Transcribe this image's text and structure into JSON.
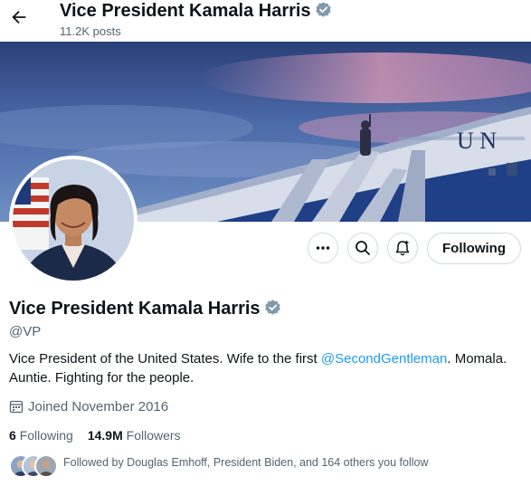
{
  "header": {
    "back_icon": "arrow-left-icon",
    "title": "Vice President Kamala Harris",
    "posts_count": "11.2K posts"
  },
  "banner": {
    "plane_text": "U N"
  },
  "actions": {
    "more_icon": "more-dots-icon",
    "search_icon": "search-icon",
    "notify_icon": "bell-plus-icon",
    "follow_label": "Following"
  },
  "profile": {
    "name": "Vice President Kamala Harris",
    "handle": "@VP",
    "bio_before": "Vice President of the United States. Wife to the first ",
    "bio_mention": "@SecondGentleman",
    "bio_after": ". Momala. Auntie. Fighting for the people.",
    "joined": "Joined November 2016",
    "following_count": "6",
    "following_label": "Following",
    "followers_count": "14.9M",
    "followers_label": "Followers",
    "followed_by": "Followed by Douglas Emhoff, President Biden, and 164 others you follow"
  },
  "colors": {
    "accent": "#1d9bf0",
    "text": "#0f1419",
    "muted": "#536471",
    "border": "#cfd9de"
  }
}
